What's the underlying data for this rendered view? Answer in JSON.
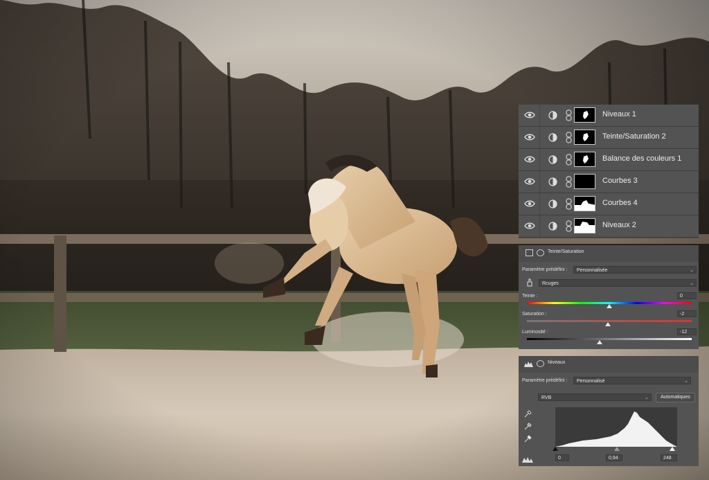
{
  "layers_panel": {
    "layers": [
      {
        "name": "Niveaux 1",
        "mask": "horse-small"
      },
      {
        "name": "Teinte/Saturation 2",
        "mask": "horse-small"
      },
      {
        "name": "Balance des couleurs 1",
        "mask": "horse-small"
      },
      {
        "name": "Courbes 3",
        "mask": "black"
      },
      {
        "name": "Courbes 4",
        "mask": "ground"
      },
      {
        "name": "Niveaux 2",
        "mask": "ground"
      }
    ]
  },
  "hue_sat_panel": {
    "title": "Teinte/Saturation",
    "preset_label": "Paramètre prédéfini :",
    "preset_value": "Personnalisée",
    "channel_value": "Rcuges",
    "hue_label": "Teinte :",
    "hue_value": "0",
    "hue_level": 0,
    "saturation_label": "Saturation :",
    "saturation_value": "-2",
    "saturation_level": -2,
    "lightness_label": "Luminosité :",
    "lightness_value": "-12",
    "lightness_level": -12
  },
  "levels_panel": {
    "title": "Niveaux",
    "preset_label": "Paramètre prédéfini :",
    "preset_value": "Personnalisé",
    "channel_value": "RVB",
    "auto_button": "Automatiques",
    "input_black": "0",
    "input_gamma": "0,94",
    "input_white": "248"
  },
  "colors": {
    "panel_bg": "#535353",
    "panel_dark": "#4a4a4a",
    "text": "#e8e8e8"
  }
}
